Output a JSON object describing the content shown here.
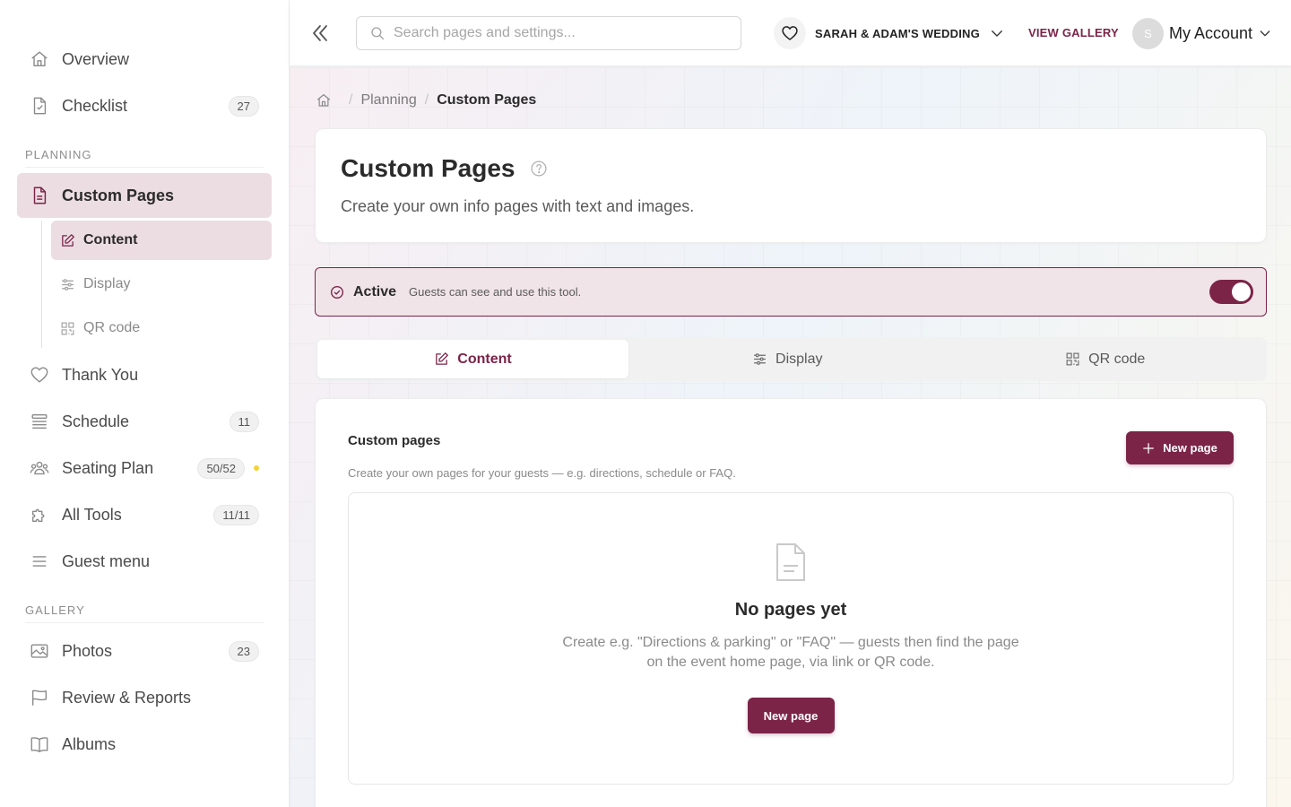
{
  "sidebar": {
    "top_items": [
      {
        "label": "Overview",
        "icon": "home-icon"
      },
      {
        "label": "Checklist",
        "icon": "checklist-icon",
        "badge": "27"
      }
    ],
    "planning_title": "PLANNING",
    "planning_active": {
      "label": "Custom Pages",
      "icon": "document-icon"
    },
    "subnav": [
      {
        "label": "Content",
        "icon": "edit-icon"
      },
      {
        "label": "Display",
        "icon": "sliders-icon"
      },
      {
        "label": "QR code",
        "icon": "qr-code-icon"
      }
    ],
    "planning_items": [
      {
        "label": "Thank You",
        "icon": "heart-icon"
      },
      {
        "label": "Schedule",
        "icon": "list-icon",
        "badge": "11"
      },
      {
        "label": "Seating Plan",
        "icon": "users-icon",
        "badge": "50/52"
      },
      {
        "label": "All Tools",
        "icon": "puzzle-icon",
        "badge": "11/11"
      },
      {
        "label": "Guest menu",
        "icon": "menu-icon"
      }
    ],
    "gallery_title": "GALLERY",
    "gallery_items": [
      {
        "label": "Photos",
        "icon": "image-icon",
        "badge": "23"
      },
      {
        "label": "Review & Reports",
        "icon": "flag-icon"
      },
      {
        "label": "Albums",
        "icon": "book-icon"
      }
    ]
  },
  "topbar": {
    "search_placeholder": "Search pages and settings...",
    "event_name": "SARAH & ADAM'S WEDDING",
    "view_gallery": "VIEW GALLERY",
    "avatar_initial": "S",
    "account_label": "My Account"
  },
  "breadcrumb": {
    "parent": "Planning",
    "current": "Custom Pages"
  },
  "header": {
    "title": "Custom Pages",
    "subtitle": "Create your own info pages with text and images."
  },
  "status": {
    "label": "Active",
    "description": "Guests can see and use this tool.",
    "enabled": true
  },
  "tabs": [
    {
      "label": "Content",
      "icon": "edit-icon"
    },
    {
      "label": "Display",
      "icon": "sliders-icon"
    },
    {
      "label": "QR code",
      "icon": "qr-code-icon"
    }
  ],
  "custom_pages": {
    "title": "Custom pages",
    "description": "Create your own pages for your guests — e.g. directions, schedule or FAQ.",
    "new_page_button": "New page",
    "empty_title": "No pages yet",
    "empty_text": "Create e.g. \"Directions & parking\" or \"FAQ\" — guests then find the page on the event home page, via link or QR code.",
    "empty_button": "New page"
  },
  "colors": {
    "accent": "#7b2448",
    "accent_soft": "#ecdde2",
    "status_dot": "#f2d236"
  }
}
